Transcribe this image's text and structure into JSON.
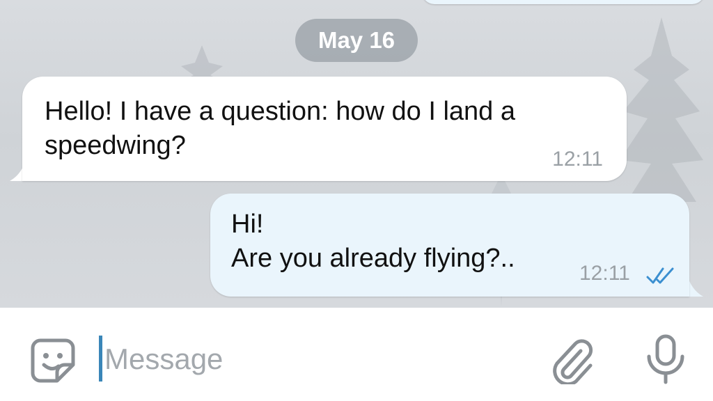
{
  "date_divider": "May 16",
  "messages": [
    {
      "direction": "incoming",
      "text": "Hello! I have a question: how do I land a\nspeedwing?",
      "time": "12:11"
    },
    {
      "direction": "outgoing",
      "text": "Hi!\nAre you already flying?..",
      "time": "12:11",
      "status_icon": "double-check-icon"
    }
  ],
  "composer": {
    "placeholder": "Message",
    "value": "",
    "left_icon": "sticker-icon",
    "right_icons": [
      "paperclip-icon",
      "microphone-icon"
    ]
  },
  "colors": {
    "incoming_bubble": "#ffffff",
    "outgoing_bubble": "#eaf5fc",
    "read_check": "#3b8fd0",
    "cursor": "#3a86b8"
  }
}
